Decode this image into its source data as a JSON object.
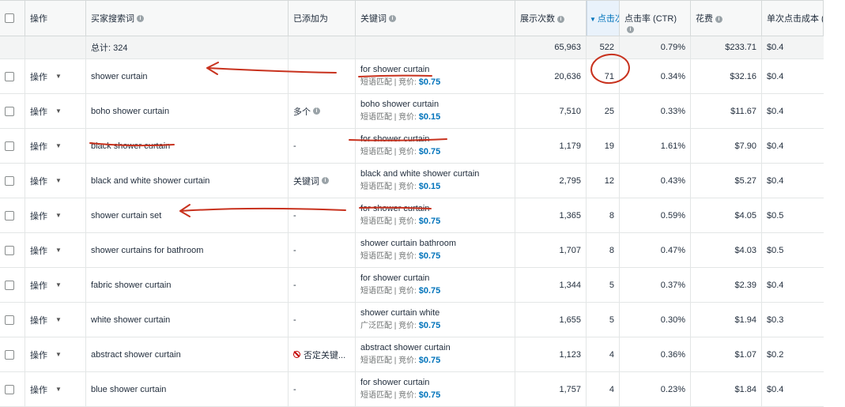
{
  "header": {
    "ops": "操作",
    "search_term": "买家搜索词",
    "added_as": "已添加为",
    "keyword": "关键词",
    "impressions": "展示次数",
    "clicks": "点击次",
    "ctr": "点击率 (CTR)",
    "cost": "花费",
    "cpc": "单次点击成本 (C"
  },
  "total": {
    "label": "总计: 324",
    "impressions": "65,963",
    "clicks": "522",
    "ctr": "0.79%",
    "cost": "$233.71",
    "cpc": "$0.4"
  },
  "bid_label": "竞价:",
  "rows": [
    {
      "op": "操作",
      "term": "shower curtain",
      "added": "",
      "keyword": "for shower curtain",
      "match": "短语匹配",
      "bid": "$0.75",
      "impressions": "20,636",
      "clicks": "71",
      "ctr": "0.34%",
      "cost": "$32.16",
      "cpc": "$0.4"
    },
    {
      "op": "操作",
      "term": "boho shower curtain",
      "added": "多个",
      "keyword": "boho shower curtain",
      "match": "短语匹配",
      "bid": "$0.15",
      "impressions": "7,510",
      "clicks": "25",
      "ctr": "0.33%",
      "cost": "$11.67",
      "cpc": "$0.4"
    },
    {
      "op": "操作",
      "term": "black shower curtain",
      "added": "-",
      "keyword": "for shower curtain",
      "match": "短语匹配",
      "bid": "$0.75",
      "impressions": "1,179",
      "clicks": "19",
      "ctr": "1.61%",
      "cost": "$7.90",
      "cpc": "$0.4"
    },
    {
      "op": "操作",
      "term": "black and white shower curtain",
      "added": "关键词",
      "keyword": "black and white shower curtain",
      "match": "短语匹配",
      "bid": "$0.15",
      "impressions": "2,795",
      "clicks": "12",
      "ctr": "0.43%",
      "cost": "$5.27",
      "cpc": "$0.4"
    },
    {
      "op": "操作",
      "term": "shower curtain set",
      "added": "-",
      "keyword": "for shower curtain",
      "match": "短语匹配",
      "bid": "$0.75",
      "impressions": "1,365",
      "clicks": "8",
      "ctr": "0.59%",
      "cost": "$4.05",
      "cpc": "$0.5"
    },
    {
      "op": "操作",
      "term": "shower curtains for bathroom",
      "added": "-",
      "keyword": "shower curtain bathroom",
      "match": "短语匹配",
      "bid": "$0.75",
      "impressions": "1,707",
      "clicks": "8",
      "ctr": "0.47%",
      "cost": "$4.03",
      "cpc": "$0.5"
    },
    {
      "op": "操作",
      "term": "fabric shower curtain",
      "added": "-",
      "keyword": "for shower curtain",
      "match": "短语匹配",
      "bid": "$0.75",
      "impressions": "1,344",
      "clicks": "5",
      "ctr": "0.37%",
      "cost": "$2.39",
      "cpc": "$0.4"
    },
    {
      "op": "操作",
      "term": "white shower curtain",
      "added": "-",
      "keyword": "shower curtain white",
      "match": "广泛匹配",
      "bid": "$0.75",
      "impressions": "1,655",
      "clicks": "5",
      "ctr": "0.30%",
      "cost": "$1.94",
      "cpc": "$0.3"
    },
    {
      "op": "操作",
      "term": "abstract shower curtain",
      "added": "否定关键...",
      "keyword": "abstract shower curtain",
      "match": "短语匹配",
      "bid": "$0.75",
      "impressions": "1,123",
      "clicks": "4",
      "ctr": "0.36%",
      "cost": "$1.07",
      "cpc": "$0.2"
    },
    {
      "op": "操作",
      "term": "blue shower curtain",
      "added": "-",
      "keyword": "for shower curtain",
      "match": "短语匹配",
      "bid": "$0.75",
      "impressions": "1,757",
      "clicks": "4",
      "ctr": "0.23%",
      "cost": "$1.84",
      "cpc": "$0.4"
    }
  ],
  "colors": {
    "annotation": "#c8321e",
    "bid": "#0073bb"
  }
}
